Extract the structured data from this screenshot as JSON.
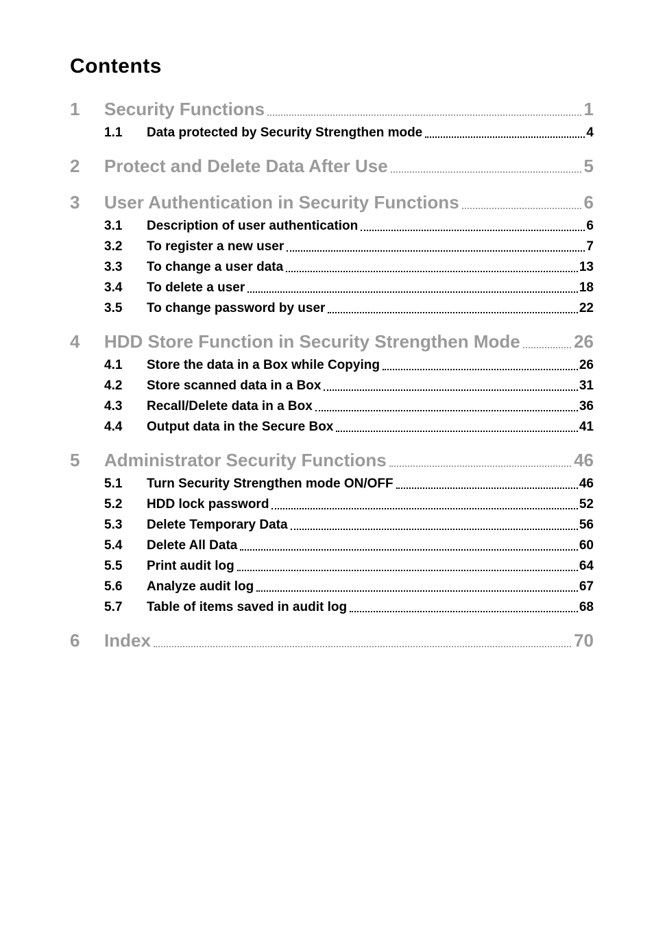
{
  "title": "Contents",
  "chapters": [
    {
      "num": "1",
      "title": "Security Functions",
      "page": "1",
      "subs": [
        {
          "num": "1.1",
          "title": "Data protected by Security Strengthen mode",
          "page": "4"
        }
      ]
    },
    {
      "num": "2",
      "title": "Protect and Delete Data After Use",
      "page": "5",
      "subs": []
    },
    {
      "num": "3",
      "title": "User Authentication in Security Functions",
      "page": "6",
      "subs": [
        {
          "num": "3.1",
          "title": "Description of user authentication",
          "page": "6"
        },
        {
          "num": "3.2",
          "title": "To register a new user",
          "page": "7"
        },
        {
          "num": "3.3",
          "title": "To change a user data",
          "page": "13"
        },
        {
          "num": "3.4",
          "title": "To delete a user",
          "page": "18"
        },
        {
          "num": "3.5",
          "title": "To change password by user",
          "page": "22"
        }
      ]
    },
    {
      "num": "4",
      "title": "HDD Store Function in Security Strengthen Mode",
      "page": "26",
      "subs": [
        {
          "num": "4.1",
          "title": "Store the data in a Box while Copying",
          "page": "26"
        },
        {
          "num": "4.2",
          "title": "Store scanned data in a Box",
          "page": "31"
        },
        {
          "num": "4.3",
          "title": "Recall/Delete data in a Box",
          "page": "36"
        },
        {
          "num": "4.4",
          "title": "Output data in the Secure Box",
          "page": "41"
        }
      ]
    },
    {
      "num": "5",
      "title": "Administrator Security Functions",
      "page": "46",
      "subs": [
        {
          "num": "5.1",
          "title": "Turn Security Strengthen mode ON/OFF",
          "page": "46"
        },
        {
          "num": "5.2",
          "title": "HDD lock password",
          "page": "52"
        },
        {
          "num": "5.3",
          "title": "Delete Temporary Data",
          "page": "56"
        },
        {
          "num": "5.4",
          "title": "Delete All Data",
          "page": "60"
        },
        {
          "num": "5.5",
          "title": "Print audit log",
          "page": "64"
        },
        {
          "num": "5.6",
          "title": "Analyze audit log",
          "page": "67"
        },
        {
          "num": "5.7",
          "title": "Table of items saved in audit log",
          "page": "68"
        }
      ]
    },
    {
      "num": "6",
      "title": "Index",
      "page": "70",
      "subs": []
    }
  ]
}
